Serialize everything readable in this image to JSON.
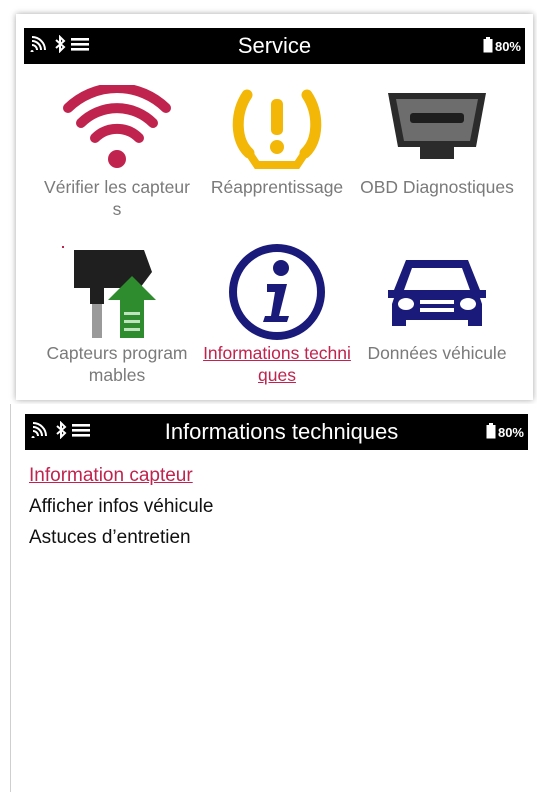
{
  "screen1": {
    "status": {
      "title": "Service",
      "battery": "80%"
    },
    "tiles": [
      {
        "label": "Vérifier les capteurs",
        "icon": "wifi-signal-icon",
        "color": "#c0234e"
      },
      {
        "label": "Réapprentissage",
        "icon": "tire-pressure-warning-icon",
        "color": "#f2b707"
      },
      {
        "label": "OBD Diagnostiques",
        "icon": "obd-connector-icon",
        "color": "#333333"
      },
      {
        "label": "Capteurs programmables",
        "icon": "sensor-upload-icon",
        "color": "#2e8b2e"
      },
      {
        "label": "Informations techniques",
        "icon": "info-icon",
        "color": "#1a1a7a",
        "active": true
      },
      {
        "label": "Données véhicule",
        "icon": "car-icon",
        "color": "#1a1a7a"
      }
    ]
  },
  "screen2": {
    "status": {
      "title": "Informations techniques",
      "battery": "80%"
    },
    "menu": [
      {
        "label": "Information capteur",
        "selected": true
      },
      {
        "label": "Afficher infos véhicule"
      },
      {
        "label": "Astuces d’entretien"
      }
    ]
  },
  "colors": {
    "accent": "#c0234e",
    "statusbar": "#000000",
    "label": "#7a7a7a"
  }
}
